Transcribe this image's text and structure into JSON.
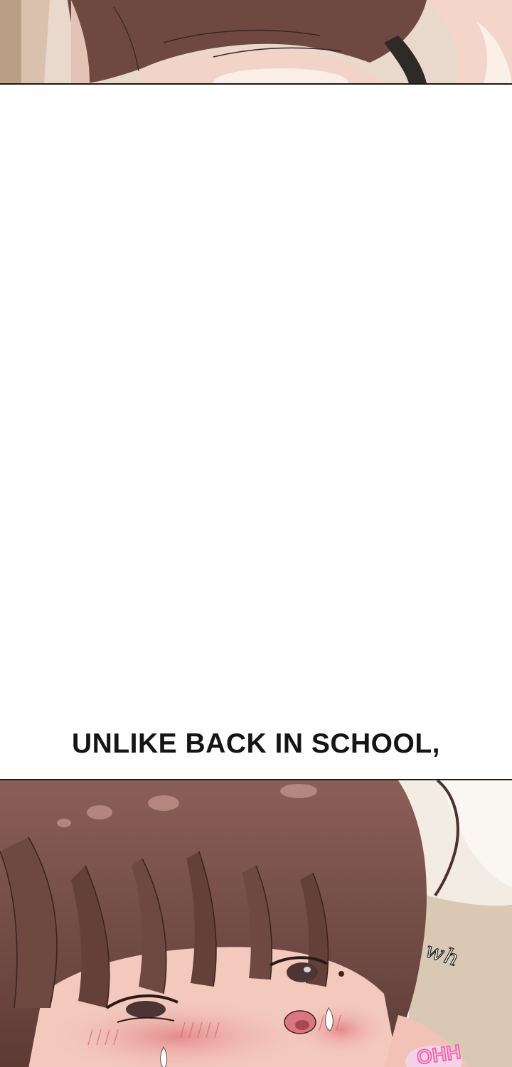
{
  "caption": "UNLIKE BACK IN SCHOOL,",
  "sfx": {
    "hair_rustle": "wh",
    "moan": "OHH"
  },
  "colors": {
    "hair": "#6f4842",
    "hair_dark": "#4e302c",
    "skin": "#f3c9bd",
    "blush": "#e58f8f",
    "background_cream": "#f2ece3",
    "sfx_pink": "#f15aa8",
    "border": "#1a1a1a"
  }
}
